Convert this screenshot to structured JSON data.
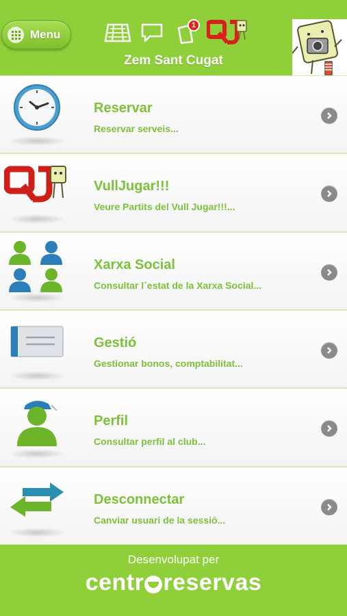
{
  "header": {
    "menu_label": "Menu",
    "title": "Zem Sant Cugat",
    "notification_count": "1",
    "icons": [
      "court-icon",
      "chat-bubble-icon",
      "notifications-icon",
      "vulljugar-logo-icon"
    ]
  },
  "items": [
    {
      "title": "Reservar",
      "subtitle": "Reservar serveis...",
      "icon": "clock-icon"
    },
    {
      "title": "VullJugar!!!",
      "subtitle": "Veure Partits del Vull Jugar!!!...",
      "icon": "vulljugar-logo-icon"
    },
    {
      "title": "Xarxa Social",
      "subtitle": "Consultar l´estat de la Xarxa Social...",
      "icon": "people-group-icon"
    },
    {
      "title": "Gestió",
      "subtitle": "Gestionar bonos, comptabilitat...",
      "icon": "card-icon"
    },
    {
      "title": "Perfil",
      "subtitle": "Consultar perfil al club...",
      "icon": "user-profile-icon"
    },
    {
      "title": "Desconnectar",
      "subtitle": "Canviar usuari de la sessió...",
      "icon": "swap-arrows-icon"
    }
  ],
  "footer": {
    "developed_by": "Desenvolupat per",
    "brand_left": "centr",
    "brand_right": "reservas"
  },
  "colors": {
    "brand_green": "#8fcf3a",
    "text_green": "#7cc13a",
    "chevron_gray": "#8a8a8a"
  }
}
